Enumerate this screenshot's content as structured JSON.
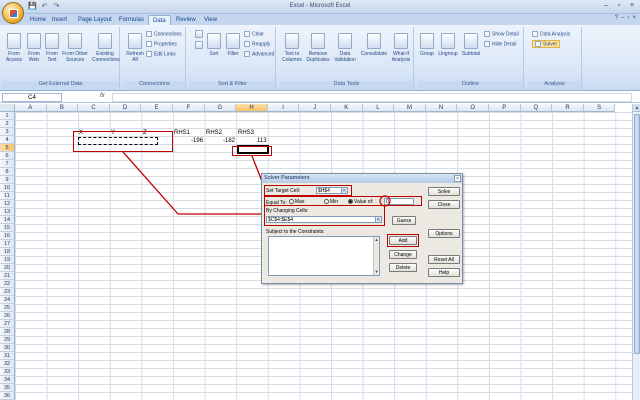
{
  "window": {
    "title": "Excel - Microsoft Excel"
  },
  "qat": [
    "💾",
    "↶",
    "↷"
  ],
  "tabs": [
    "Home",
    "Insert",
    "Page Layout",
    "Formulas",
    "Data",
    "Review",
    "View"
  ],
  "active_tab": "Data",
  "ribbon": {
    "get_external_data": {
      "name": "Get External Data",
      "buttons": [
        "From Access",
        "From Web",
        "From Text",
        "From Other Sources",
        "Existing Connections"
      ]
    },
    "connections": {
      "name": "Connections",
      "refresh": "Refresh All",
      "items": [
        "Connections",
        "Properties",
        "Edit Links"
      ]
    },
    "sort_filter": {
      "name": "Sort & Filter",
      "sort": "Sort",
      "filter": "Filter",
      "items": [
        "Clear",
        "Reapply",
        "Advanced"
      ]
    },
    "data_tools": {
      "name": "Data Tools",
      "buttons": [
        "Text to Columns",
        "Remove Duplicates",
        "Data Validation",
        "Consolidate",
        "What-If Analysis"
      ]
    },
    "outline": {
      "name": "Outline",
      "buttons": [
        "Group",
        "Ungroup",
        "Subtotal"
      ],
      "items": [
        "Show Detail",
        "Hide Detail"
      ]
    },
    "analysis": {
      "name": "Analysis",
      "items": [
        "Data Analysis",
        "Solver"
      ]
    }
  },
  "formula_bar": {
    "name_box": "C4",
    "fx": "fx",
    "value": ""
  },
  "columns": [
    "A",
    "B",
    "C",
    "D",
    "E",
    "F",
    "G",
    "H",
    "I",
    "J",
    "K",
    "L",
    "M",
    "N",
    "O",
    "P",
    "Q",
    "R",
    "S"
  ],
  "selected_column": "H",
  "rows": [
    "1",
    "2",
    "3",
    "4",
    "5",
    "6",
    "7",
    "8",
    "9",
    "10",
    "11",
    "12",
    "13",
    "14",
    "15",
    "16",
    "17",
    "18",
    "19",
    "20",
    "21",
    "22",
    "23",
    "24",
    "25",
    "26",
    "27",
    "28",
    "29",
    "30",
    "31",
    "32",
    "33",
    "34",
    "35",
    "36"
  ],
  "selected_row": "5",
  "cells": {
    "c3": "X",
    "d3": "Y",
    "e3": "Z",
    "f3": "RHS1",
    "g3": "RHS2",
    "h3": "RHS3",
    "f4": "-196",
    "g4": "-182",
    "h4": "113"
  },
  "solver": {
    "title": "Solver Parameters",
    "close": "×",
    "target_label": "Set Target Cell:",
    "target_value": "$H$4",
    "equal_to_label": "Equal To:",
    "max_label": "Max",
    "min_label": "Min",
    "value_of_label": "Value of:",
    "value_of_value": "0",
    "changing_label": "By Changing Cells:",
    "changing_value": "$C$4:$E$4",
    "guess_btn": "Guess",
    "constraints_label": "Subject to the Constraints:",
    "solve_btn": "Solve",
    "close_btn": "Close",
    "options_btn": "Options",
    "add_btn": "Add",
    "change_btn": "Change",
    "delete_btn": "Delete",
    "reset_btn": "Reset All",
    "help_btn": "Help",
    "picker": "⇱",
    "scroll_up": "▲",
    "scroll_down": "▼"
  },
  "help_ctrls": [
    "?",
    "–",
    "▫",
    "×"
  ],
  "win_ctrls": [
    "–",
    "▫",
    "×"
  ],
  "vscroll": {
    "up": "▲"
  },
  "colors": {
    "annotation": "#c00000",
    "selection": "#f7c36a",
    "ribbon": "#d9e6f6"
  }
}
